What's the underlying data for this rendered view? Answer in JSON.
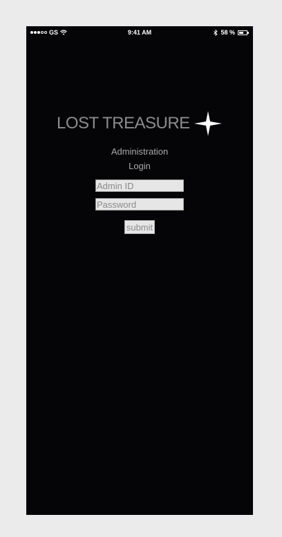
{
  "status_bar": {
    "carrier": "GS",
    "time": "9:41 AM",
    "battery_text": "58 %",
    "battery_level": 0.58,
    "signal_bars_filled": 3,
    "signal_bars_total": 5
  },
  "logo": {
    "text": "LOST TREASURE",
    "icon": "four-point-star-icon"
  },
  "heading": {
    "line1": "Administration",
    "line2": "Login"
  },
  "form": {
    "admin_id_placeholder": "Admin ID",
    "password_placeholder": "Password",
    "submit_label": "submit"
  },
  "colors": {
    "screen_bg": "#050508",
    "page_bg": "#ebebeb",
    "logo_text": "#8c8c8c",
    "heading_text": "#a8a8a8",
    "field_bg": "#e6e6e6"
  }
}
